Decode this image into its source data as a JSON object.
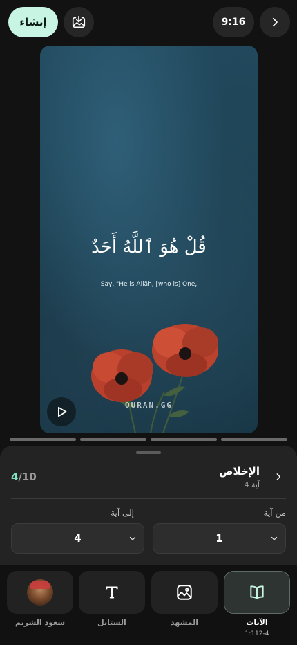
{
  "header": {
    "create_label": "إنشاء",
    "time": "9:16"
  },
  "preview": {
    "ayah_arabic": "قُلْ هُوَ ٱللَّهُ أَحَدٌ",
    "ayah_english": "Say, \"He is Allāh, [who is] One,",
    "watermark": "QURAN.GG"
  },
  "progress": {
    "segments": 4
  },
  "sheet": {
    "counter_current": "4",
    "counter_total": "/10",
    "surah_name": "الإخلاص",
    "surah_ayah_count": "4 آية",
    "from_label": "من آية",
    "to_label": "إلى آية",
    "from_value": "1",
    "to_value": "4"
  },
  "tabs": [
    {
      "label": "الآيات",
      "sub": "1:112-4",
      "icon": "book-icon",
      "active": true
    },
    {
      "label": "المشهد",
      "icon": "image-icon"
    },
    {
      "label": "الستايل",
      "icon": "text-icon"
    },
    {
      "label": "سعود الشريم",
      "icon": "reciter-avatar"
    }
  ],
  "colors": {
    "accent": "#c8f5e3",
    "counter_accent": "#7fe3c1",
    "background": "#121212"
  }
}
